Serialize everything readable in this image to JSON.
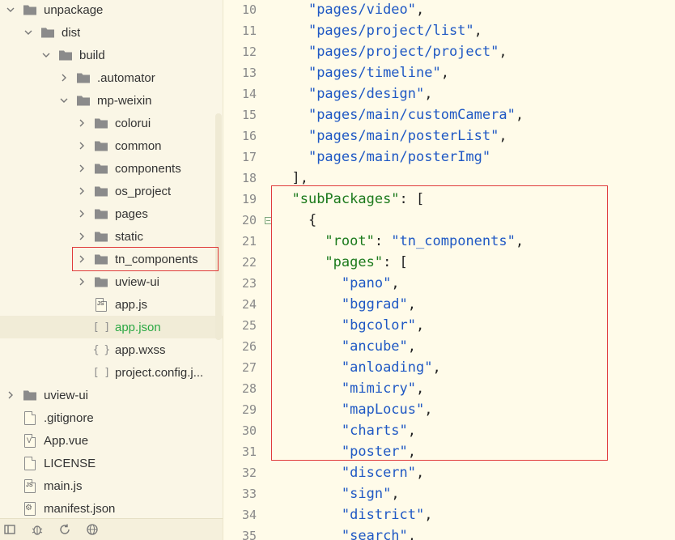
{
  "sidebar": {
    "tree": [
      {
        "label": "unpackage",
        "type": "folder",
        "depth": 0,
        "expanded": true
      },
      {
        "label": "dist",
        "type": "folder",
        "depth": 1,
        "expanded": true
      },
      {
        "label": "build",
        "type": "folder",
        "depth": 2,
        "expanded": true
      },
      {
        "label": ".automator",
        "type": "folder",
        "depth": 3,
        "expanded": false
      },
      {
        "label": "mp-weixin",
        "type": "folder",
        "depth": 3,
        "expanded": true
      },
      {
        "label": "colorui",
        "type": "folder",
        "depth": 4,
        "expanded": false
      },
      {
        "label": "common",
        "type": "folder",
        "depth": 4,
        "expanded": false
      },
      {
        "label": "components",
        "type": "folder",
        "depth": 4,
        "expanded": false
      },
      {
        "label": "os_project",
        "type": "folder",
        "depth": 4,
        "expanded": false
      },
      {
        "label": "pages",
        "type": "folder",
        "depth": 4,
        "expanded": false
      },
      {
        "label": "static",
        "type": "folder",
        "depth": 4,
        "expanded": false
      },
      {
        "label": "tn_components",
        "type": "folder",
        "depth": 4,
        "expanded": false,
        "highlighted": true
      },
      {
        "label": "uview-ui",
        "type": "folder",
        "depth": 4,
        "expanded": false
      },
      {
        "label": "app.js",
        "type": "js",
        "depth": 4
      },
      {
        "label": "app.json",
        "type": "json",
        "depth": 4,
        "selected": true
      },
      {
        "label": "app.wxss",
        "type": "css",
        "depth": 4
      },
      {
        "label": "project.config.j...",
        "type": "json",
        "depth": 4
      },
      {
        "label": "uview-ui",
        "type": "folder",
        "depth": 0,
        "expanded": false
      },
      {
        "label": ".gitignore",
        "type": "file",
        "depth": 0
      },
      {
        "label": "App.vue",
        "type": "vue",
        "depth": 0
      },
      {
        "label": "LICENSE",
        "type": "file",
        "depth": 0
      },
      {
        "label": "main.js",
        "type": "js",
        "depth": 0
      },
      {
        "label": "manifest.json",
        "type": "gearfile",
        "depth": 0
      }
    ]
  },
  "bottombar": {
    "icons": [
      "panel-icon",
      "bug-icon",
      "sync-icon",
      "network-icon"
    ]
  },
  "editor": {
    "lines": [
      {
        "n": "10",
        "tokens": [
          [
            "    ",
            ""
          ],
          [
            "\"pages/video\"",
            "str"
          ],
          [
            ",",
            "punc"
          ]
        ]
      },
      {
        "n": "11",
        "tokens": [
          [
            "    ",
            ""
          ],
          [
            "\"pages/project/list\"",
            "str"
          ],
          [
            ",",
            "punc"
          ]
        ]
      },
      {
        "n": "12",
        "tokens": [
          [
            "    ",
            ""
          ],
          [
            "\"pages/project/project\"",
            "str"
          ],
          [
            ",",
            "punc"
          ]
        ]
      },
      {
        "n": "13",
        "tokens": [
          [
            "    ",
            ""
          ],
          [
            "\"pages/timeline\"",
            "str"
          ],
          [
            ",",
            "punc"
          ]
        ]
      },
      {
        "n": "14",
        "tokens": [
          [
            "    ",
            ""
          ],
          [
            "\"pages/design\"",
            "str"
          ],
          [
            ",",
            "punc"
          ]
        ]
      },
      {
        "n": "15",
        "tokens": [
          [
            "    ",
            ""
          ],
          [
            "\"pages/main/customCamera\"",
            "str"
          ],
          [
            ",",
            "punc"
          ]
        ]
      },
      {
        "n": "16",
        "tokens": [
          [
            "    ",
            ""
          ],
          [
            "\"pages/main/posterList\"",
            "str"
          ],
          [
            ",",
            "punc"
          ]
        ]
      },
      {
        "n": "17",
        "tokens": [
          [
            "    ",
            ""
          ],
          [
            "\"pages/main/posterImg\"",
            "str"
          ],
          [
            "",
            "punc"
          ]
        ]
      },
      {
        "n": "18",
        "tokens": [
          [
            "  ",
            ""
          ],
          [
            "],",
            "punc"
          ]
        ]
      },
      {
        "n": "19",
        "tokens": [
          [
            "  ",
            ""
          ],
          [
            "\"subPackages\"",
            "key"
          ],
          [
            ": [",
            "punc"
          ]
        ]
      },
      {
        "n": "20",
        "tokens": [
          [
            "    ",
            ""
          ],
          [
            "{",
            "punc"
          ]
        ],
        "fold": true
      },
      {
        "n": "21",
        "tokens": [
          [
            "      ",
            ""
          ],
          [
            "\"root\"",
            "key"
          ],
          [
            ": ",
            "punc"
          ],
          [
            "\"tn_components\"",
            "str"
          ],
          [
            ",",
            "punc"
          ]
        ]
      },
      {
        "n": "22",
        "tokens": [
          [
            "      ",
            ""
          ],
          [
            "\"pages\"",
            "key"
          ],
          [
            ": [",
            "punc"
          ]
        ]
      },
      {
        "n": "23",
        "tokens": [
          [
            "        ",
            ""
          ],
          [
            "\"pano\"",
            "str"
          ],
          [
            ",",
            "punc"
          ]
        ]
      },
      {
        "n": "24",
        "tokens": [
          [
            "        ",
            ""
          ],
          [
            "\"bggrad\"",
            "str"
          ],
          [
            ",",
            "punc"
          ]
        ]
      },
      {
        "n": "25",
        "tokens": [
          [
            "        ",
            ""
          ],
          [
            "\"bgcolor\"",
            "str"
          ],
          [
            ",",
            "punc"
          ]
        ]
      },
      {
        "n": "26",
        "tokens": [
          [
            "        ",
            ""
          ],
          [
            "\"ancube\"",
            "str"
          ],
          [
            ",",
            "punc"
          ]
        ]
      },
      {
        "n": "27",
        "tokens": [
          [
            "        ",
            ""
          ],
          [
            "\"anloading\"",
            "str"
          ],
          [
            ",",
            "punc"
          ]
        ]
      },
      {
        "n": "28",
        "tokens": [
          [
            "        ",
            ""
          ],
          [
            "\"mimicry\"",
            "str"
          ],
          [
            ",",
            "punc"
          ]
        ]
      },
      {
        "n": "29",
        "tokens": [
          [
            "        ",
            ""
          ],
          [
            "\"mapLocus\"",
            "str"
          ],
          [
            ",",
            "punc"
          ]
        ]
      },
      {
        "n": "30",
        "tokens": [
          [
            "        ",
            ""
          ],
          [
            "\"charts\"",
            "str"
          ],
          [
            ",",
            "punc"
          ]
        ]
      },
      {
        "n": "31",
        "tokens": [
          [
            "        ",
            ""
          ],
          [
            "\"poster\"",
            "str"
          ],
          [
            ",",
            "punc"
          ]
        ]
      },
      {
        "n": "32",
        "tokens": [
          [
            "        ",
            ""
          ],
          [
            "\"discern\"",
            "str"
          ],
          [
            ",",
            "punc"
          ]
        ]
      },
      {
        "n": "33",
        "tokens": [
          [
            "        ",
            ""
          ],
          [
            "\"sign\"",
            "str"
          ],
          [
            ",",
            "punc"
          ]
        ]
      },
      {
        "n": "34",
        "tokens": [
          [
            "        ",
            ""
          ],
          [
            "\"district\"",
            "str"
          ],
          [
            ",",
            "punc"
          ]
        ]
      },
      {
        "n": "35",
        "tokens": [
          [
            "        ",
            ""
          ],
          [
            "\"search\"",
            "str"
          ],
          [
            ",",
            "punc"
          ]
        ]
      }
    ]
  },
  "colors": {
    "string": "#1f58c4",
    "key": "#1c7a1c",
    "selected_file": "#2aa843",
    "highlight_box": "#e03b3b"
  }
}
